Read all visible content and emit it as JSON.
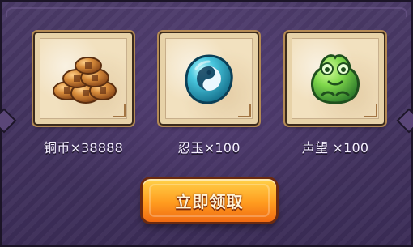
{
  "rewards": [
    {
      "name": "铜币",
      "quantity_text": "×38888",
      "label": "铜币×38888",
      "icon": "copper-coins-icon"
    },
    {
      "name": "忍玉",
      "quantity_text": "×100",
      "label": "忍玉×100",
      "icon": "jade-orb-icon"
    },
    {
      "name": "声望",
      "quantity_text": "×100",
      "label": "声望 ×100",
      "icon": "frog-icon"
    }
  ],
  "claim_button": {
    "label": "立即领取"
  },
  "colors": {
    "panel": "#4a3a67",
    "card": "#f2e1bf",
    "button_top": "#ffd24a",
    "button_bottom": "#f06a12"
  }
}
